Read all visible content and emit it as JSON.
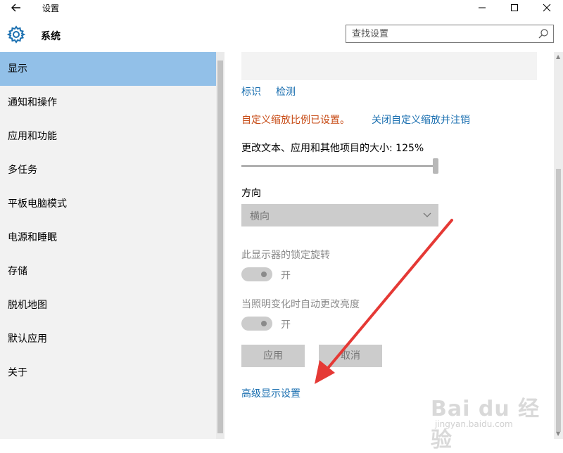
{
  "window": {
    "title": "设置",
    "back_icon": "back-arrow-icon",
    "minimize_glyph": "—",
    "maximize_glyph": "☐",
    "close_glyph": "✕"
  },
  "header": {
    "title": "系统",
    "icon": "gear-icon"
  },
  "search": {
    "placeholder": "查找设置",
    "icon": "search-icon"
  },
  "sidebar": {
    "items": [
      {
        "label": "显示",
        "active": true
      },
      {
        "label": "通知和操作"
      },
      {
        "label": "应用和功能"
      },
      {
        "label": "多任务"
      },
      {
        "label": "平板电脑模式"
      },
      {
        "label": "电源和睡眠"
      },
      {
        "label": "存储"
      },
      {
        "label": "脱机地图"
      },
      {
        "label": "默认应用"
      },
      {
        "label": "关于"
      }
    ]
  },
  "display": {
    "identify_link": "标识",
    "detect_link": "检测",
    "custom_scale_notice": "自定义缩放比例已设置。",
    "disable_custom_scale_link": "关闭自定义缩放并注销",
    "size_label": "更改文本、应用和其他项目的大小: 125%",
    "size_slider_level": 1.0,
    "orientation_label": "方向",
    "orientation_value": "横向",
    "rotation_lock_label": "此显示器的锁定旋转",
    "rotation_lock_state": "开",
    "auto_brightness_label": "当照明变化时自动更改亮度",
    "auto_brightness_state": "开",
    "apply_button": "应用",
    "cancel_button": "取消",
    "advanced_link": "高级显示设置"
  },
  "colors": {
    "accent": "#92c0e8",
    "link": "#1a6fb0",
    "warning": "#c74a14",
    "annotation_arrow": "#e53935"
  },
  "watermark": {
    "brand": "Bai du 经验",
    "site": "jingyan.baidu.com"
  }
}
